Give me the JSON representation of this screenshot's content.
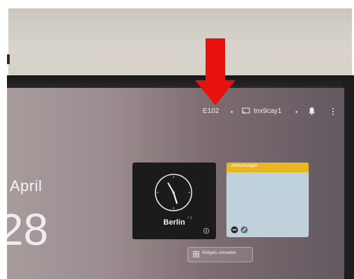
{
  "statusbar": {
    "room": "E102",
    "user": "tnx9cay1"
  },
  "home": {
    "date": ". April",
    "time": "28"
  },
  "clock_widget": {
    "city": "Berlin",
    "offset": "+1"
  },
  "notes_widget": {
    "title": "Anmerkungen"
  },
  "manage_widgets": {
    "label": "Widgets verwalten"
  },
  "icons": {
    "cast": "screen-cast-icon",
    "bell": "bell-icon",
    "more": "more-vertical-icon",
    "settings": "settings-icon",
    "remove": "remove-icon",
    "edit": "edit-icon",
    "widgets": "widgets-grid-icon"
  },
  "colors": {
    "annotation_arrow": "#e8120c",
    "notes_header": "#e8b823",
    "notes_body": "#bfd2dc",
    "clock_background": "#1b1b1c"
  }
}
